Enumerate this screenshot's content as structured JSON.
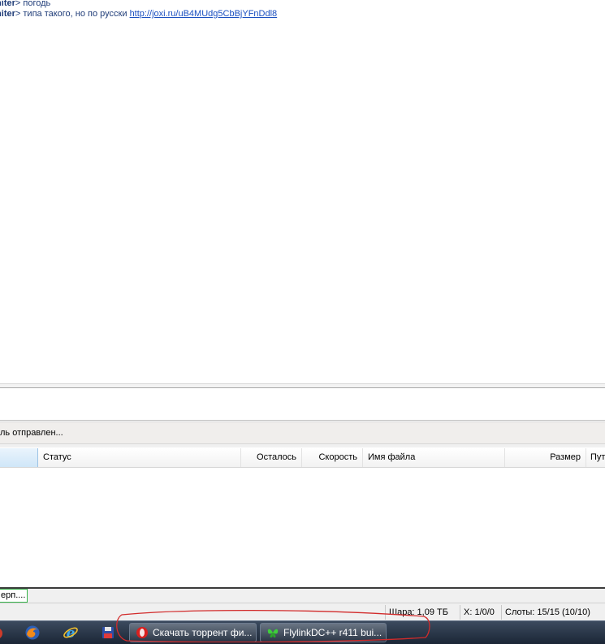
{
  "chat": {
    "lines": [
      {
        "nick": "initer",
        "sep": "> ",
        "text": "погодь",
        "link": ""
      },
      {
        "nick": "initer",
        "sep": "> ",
        "text": "типа такого, но по русски ",
        "link": "http://joxi.ru/uB4MUdg5CbBjYFnDdl8"
      }
    ]
  },
  "status_message": "ль отправлен...",
  "table": {
    "columns": [
      "",
      "Статус",
      "Осталось",
      "Скорость",
      "Имя файла",
      "Размер",
      "Пут"
    ]
  },
  "tabs": [
    {
      "label": "ерп...."
    }
  ],
  "statusbar": {
    "share": "Шара: 1,09 ТБ",
    "hubs": "Х: 1/0/0",
    "slots": "Слоты: 15/15 (10/10)"
  },
  "taskbar": {
    "buttons": [
      {
        "label": "Скачать торрент фи..."
      },
      {
        "label": "FlylinkDC++ r411 bui..."
      }
    ]
  },
  "colors": {
    "nick": "#1f3c78",
    "link": "#1a4fc0",
    "tab_border": "#37b34a",
    "annotation": "#d22b2b"
  },
  "icons": [
    "firefox-icon",
    "internet-explorer-icon",
    "save-disk-icon",
    "opera-icon",
    "flylink-butterfly-icon"
  ]
}
